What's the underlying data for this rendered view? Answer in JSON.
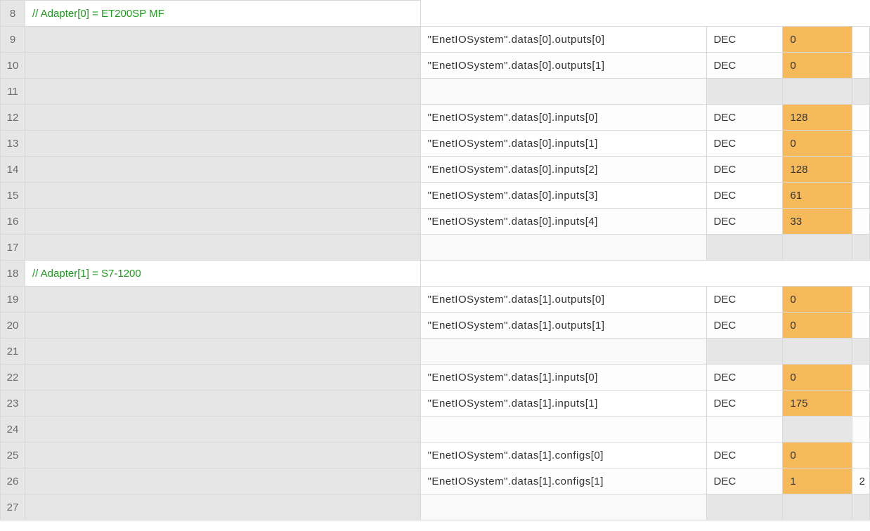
{
  "rows": [
    {
      "ln": "8",
      "type": "comment",
      "text": "// Adapter[0] = ET200SP MF"
    },
    {
      "ln": "9",
      "type": "data",
      "name": "\"EnetIOSystem\".datas[0].outputs[0]",
      "fmt": "DEC",
      "val": "0",
      "extra": ""
    },
    {
      "ln": "10",
      "type": "data",
      "name": "\"EnetIOSystem\".datas[0].outputs[1]",
      "fmt": "DEC",
      "val": "0",
      "extra": ""
    },
    {
      "ln": "11",
      "type": "blank"
    },
    {
      "ln": "12",
      "type": "data",
      "name": "\"EnetIOSystem\".datas[0].inputs[0]",
      "fmt": "DEC",
      "val": "128",
      "extra": ""
    },
    {
      "ln": "13",
      "type": "data",
      "name": "\"EnetIOSystem\".datas[0].inputs[1]",
      "fmt": "DEC",
      "val": "0",
      "extra": ""
    },
    {
      "ln": "14",
      "type": "data",
      "name": "\"EnetIOSystem\".datas[0].inputs[2]",
      "fmt": "DEC",
      "val": "128",
      "extra": ""
    },
    {
      "ln": "15",
      "type": "data",
      "name": "\"EnetIOSystem\".datas[0].inputs[3]",
      "fmt": "DEC",
      "val": "61",
      "extra": ""
    },
    {
      "ln": "16",
      "type": "data",
      "name": "\"EnetIOSystem\".datas[0].inputs[4]",
      "fmt": "DEC",
      "val": "33",
      "extra": ""
    },
    {
      "ln": "17",
      "type": "blank"
    },
    {
      "ln": "18",
      "type": "comment",
      "text": "// Adapter[1] = S7-1200"
    },
    {
      "ln": "19",
      "type": "data",
      "name": "\"EnetIOSystem\".datas[1].outputs[0]",
      "fmt": "DEC",
      "val": "0",
      "extra": ""
    },
    {
      "ln": "20",
      "type": "data",
      "name": "\"EnetIOSystem\".datas[1].outputs[1]",
      "fmt": "DEC",
      "val": "0",
      "extra": ""
    },
    {
      "ln": "21",
      "type": "blank"
    },
    {
      "ln": "22",
      "type": "data",
      "name": "\"EnetIOSystem\".datas[1].inputs[0]",
      "fmt": "DEC",
      "val": "0",
      "extra": ""
    },
    {
      "ln": "23",
      "type": "data",
      "name": "\"EnetIOSystem\".datas[1].inputs[1]",
      "fmt": "DEC",
      "val": "175",
      "extra": ""
    },
    {
      "ln": "24",
      "type": "blank"
    },
    {
      "ln": "25",
      "type": "data",
      "name": "\"EnetIOSystem\".datas[1].configs[0]",
      "fmt": "DEC",
      "val": "0",
      "extra": ""
    },
    {
      "ln": "26",
      "type": "data",
      "name": "\"EnetIOSystem\".datas[1].configs[1]",
      "fmt": "DEC",
      "val": "1",
      "extra": "2"
    },
    {
      "ln": "27",
      "type": "blank"
    }
  ]
}
